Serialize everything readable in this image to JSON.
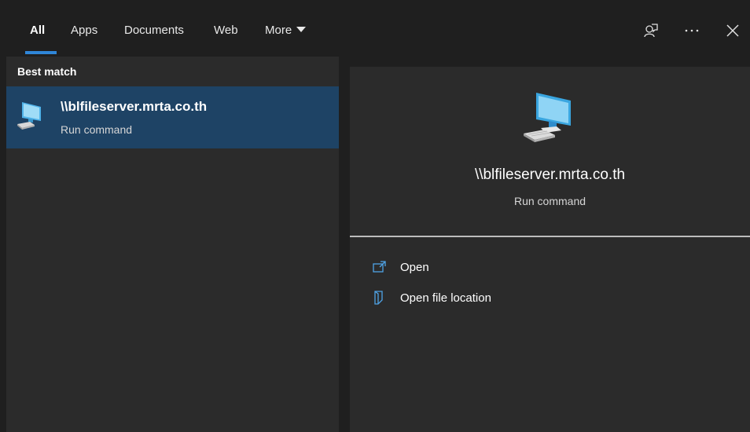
{
  "tabs": [
    {
      "label": "All"
    },
    {
      "label": "Apps"
    },
    {
      "label": "Documents"
    },
    {
      "label": "Web"
    },
    {
      "label": "More"
    }
  ],
  "top_icons": [
    "feedback-icon",
    "more-options-icon",
    "close-icon"
  ],
  "left": {
    "section_title": "Best match",
    "result": {
      "title": "\\\\blfileserver.mrta.co.th",
      "subtitle": "Run command",
      "icon": "computer-icon"
    }
  },
  "detail": {
    "title": "\\\\blfileserver.mrta.co.th",
    "subtitle": "Run command",
    "actions": [
      {
        "label": "Open",
        "icon": "open-icon"
      },
      {
        "label": "Open file location",
        "icon": "file-location-icon"
      }
    ]
  },
  "colors": {
    "accent": "#2f86d8",
    "selected_bg": "#1e4365",
    "panel_bg": "#2b2b2b",
    "header_bg": "#1f1f1f"
  }
}
